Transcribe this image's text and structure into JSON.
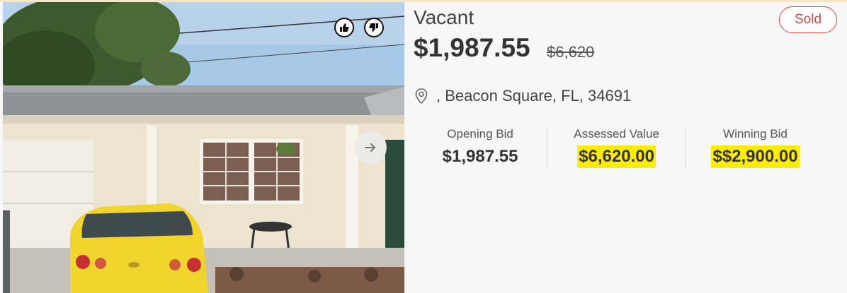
{
  "listing": {
    "title": "Vacant",
    "price": "$1,987.55",
    "old_price": "$6,620",
    "status_badge": "Sold",
    "address": ", Beacon Square, FL, 34691"
  },
  "stats": [
    {
      "label": "Opening Bid",
      "value": "$1,987.55",
      "highlight": false
    },
    {
      "label": "Assessed Value",
      "value": "$6,620.00",
      "highlight": true
    },
    {
      "label": "Winning Bid",
      "value": "$$2,900.00",
      "highlight": true
    }
  ],
  "icons": {
    "thumbs_up": "thumbs-up-icon",
    "thumbs_down": "thumbs-down-icon",
    "next": "arrow-right-icon",
    "location": "location-pin-icon"
  },
  "colors": {
    "sold": "#d9453f",
    "highlight": "#ffec00",
    "car": "#f2d52c"
  }
}
